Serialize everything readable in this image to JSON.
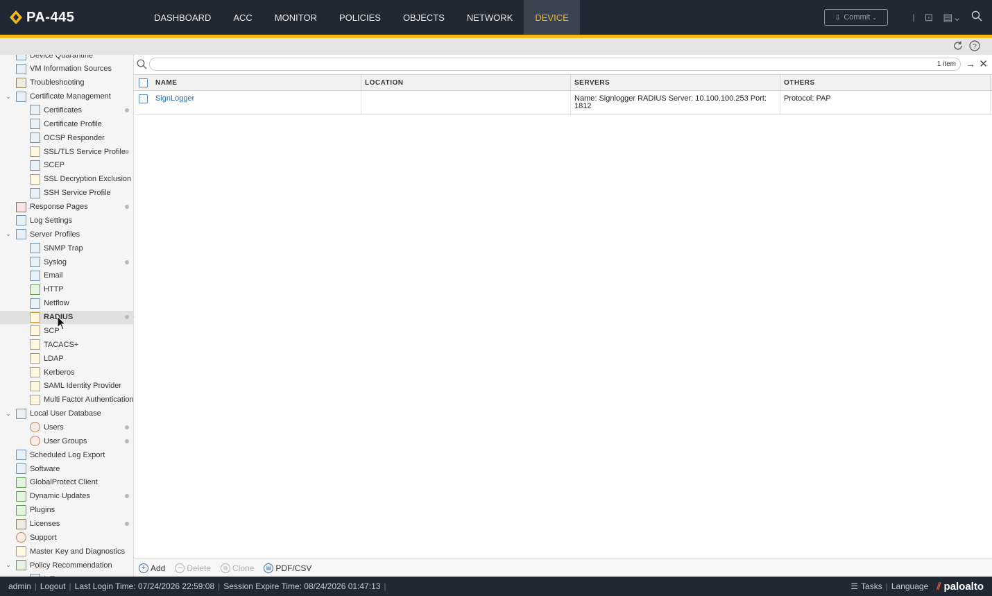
{
  "app": {
    "title": "PA-445"
  },
  "nav": {
    "tabs": [
      "DASHBOARD",
      "ACC",
      "MONITOR",
      "POLICIES",
      "OBJECTS",
      "NETWORK",
      "DEVICE"
    ],
    "active": "DEVICE"
  },
  "toolbar": {
    "commit_label": "Commit"
  },
  "sidebar": {
    "items": [
      {
        "label": "Device Quarantine",
        "level": 1,
        "icon": "quarantine-icon"
      },
      {
        "label": "VM Information Sources",
        "level": 1,
        "icon": "vm-info-icon"
      },
      {
        "label": "Troubleshooting",
        "level": 1,
        "icon": "tools-icon"
      },
      {
        "label": "Certificate Management",
        "level": 1,
        "icon": "certificate-icon",
        "expanded": true
      },
      {
        "label": "Certificates",
        "level": 2,
        "icon": "certificate-icon",
        "dot": true
      },
      {
        "label": "Certificate Profile",
        "level": 2,
        "icon": "certificate-profile-icon"
      },
      {
        "label": "OCSP Responder",
        "level": 2,
        "icon": "ocsp-icon"
      },
      {
        "label": "SSL/TLS Service Profile",
        "level": 2,
        "icon": "lock-icon",
        "dot": true
      },
      {
        "label": "SCEP",
        "level": 2,
        "icon": "scep-icon"
      },
      {
        "label": "SSL Decryption Exclusion",
        "level": 2,
        "icon": "lock-icon"
      },
      {
        "label": "SSH Service Profile",
        "level": 2,
        "icon": "ssh-icon"
      },
      {
        "label": "Response Pages",
        "level": 1,
        "icon": "response-pages-icon",
        "dot": true
      },
      {
        "label": "Log Settings",
        "level": 1,
        "icon": "log-settings-icon"
      },
      {
        "label": "Server Profiles",
        "level": 1,
        "icon": "server-profiles-icon",
        "expanded": true
      },
      {
        "label": "SNMP Trap",
        "level": 2,
        "icon": "snmp-icon"
      },
      {
        "label": "Syslog",
        "level": 2,
        "icon": "syslog-icon",
        "dot": true
      },
      {
        "label": "Email",
        "level": 2,
        "icon": "email-icon"
      },
      {
        "label": "HTTP",
        "level": 2,
        "icon": "http-icon"
      },
      {
        "label": "Netflow",
        "level": 2,
        "icon": "netflow-icon"
      },
      {
        "label": "RADIUS",
        "level": 2,
        "icon": "radius-icon",
        "dot": true,
        "selected": true
      },
      {
        "label": "SCP",
        "level": 2,
        "icon": "scp-icon"
      },
      {
        "label": "TACACS+",
        "level": 2,
        "icon": "tacacs-icon"
      },
      {
        "label": "LDAP",
        "level": 2,
        "icon": "ldap-icon"
      },
      {
        "label": "Kerberos",
        "level": 2,
        "icon": "kerberos-icon"
      },
      {
        "label": "SAML Identity Provider",
        "level": 2,
        "icon": "saml-icon"
      },
      {
        "label": "Multi Factor Authentication",
        "level": 2,
        "icon": "mfa-icon"
      },
      {
        "label": "Local User Database",
        "level": 1,
        "icon": "user-database-icon",
        "expanded": true
      },
      {
        "label": "Users",
        "level": 2,
        "icon": "user-icon",
        "dot": true
      },
      {
        "label": "User Groups",
        "level": 2,
        "icon": "user-group-icon",
        "dot": true
      },
      {
        "label": "Scheduled Log Export",
        "level": 1,
        "icon": "log-export-icon"
      },
      {
        "label": "Software",
        "level": 1,
        "icon": "software-icon"
      },
      {
        "label": "GlobalProtect Client",
        "level": 1,
        "icon": "globalprotect-icon"
      },
      {
        "label": "Dynamic Updates",
        "level": 1,
        "icon": "dynamic-updates-icon",
        "dot": true
      },
      {
        "label": "Plugins",
        "level": 1,
        "icon": "plugins-icon"
      },
      {
        "label": "Licenses",
        "level": 1,
        "icon": "key-icon",
        "dot": true
      },
      {
        "label": "Support",
        "level": 1,
        "icon": "support-icon"
      },
      {
        "label": "Master Key and Diagnostics",
        "level": 1,
        "icon": "lock-icon"
      },
      {
        "label": "Policy Recommendation",
        "level": 1,
        "icon": "policy-recommendation-icon",
        "expanded": true
      },
      {
        "label": "IoT",
        "level": 2,
        "icon": "iot-icon"
      }
    ]
  },
  "search": {
    "value": "",
    "count_label": "1 item"
  },
  "table": {
    "columns": [
      "NAME",
      "LOCATION",
      "SERVERS",
      "OTHERS"
    ],
    "rows": [
      {
        "name": "SignLogger",
        "location": "",
        "servers_line1": "Name: Signlogger RADIUS Server: 10.100.100.253 Port:",
        "servers_line2": "1812",
        "others": "Protocol: PAP"
      }
    ]
  },
  "actions": {
    "add": "Add",
    "delete": "Delete",
    "clone": "Clone",
    "pdf_csv": "PDF/CSV"
  },
  "statusbar": {
    "user": "admin",
    "logout": "Logout",
    "last_login": "Last Login Time: 07/24/2026 22:59:08",
    "session_expire": "Session Expire Time: 08/24/2026 01:47:13",
    "tasks": "Tasks",
    "language": "Language",
    "brand": "paloalto"
  },
  "colors": {
    "accent": "#f6b91b",
    "topbar": "#1f2833",
    "link": "#1e6fb8",
    "brand_mark": "#fa582d"
  }
}
